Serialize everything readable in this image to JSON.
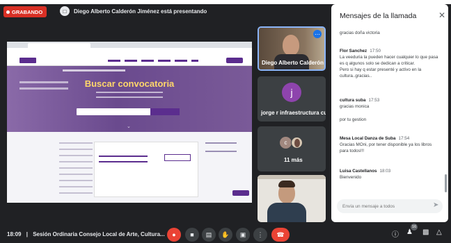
{
  "recording": {
    "label": "GRABANDO"
  },
  "presenter": {
    "text": "Diego Alberto Calderón Jiménez está presentando"
  },
  "shared_screen": {
    "site_title": "Buscar convocatoria"
  },
  "participants": [
    {
      "name": "Diego Alberto Calderón"
    },
    {
      "name": "jorge r infraestructura cul...",
      "initial": "j",
      "avatar_color": "#8e44ad"
    },
    {
      "name": "11 más",
      "initial": "c"
    },
    {
      "name": ""
    }
  ],
  "chat": {
    "title": "Mensajes de la llamada",
    "messages": [
      {
        "sender": "",
        "time": "",
        "lines": [
          "gracias  doña victoria"
        ]
      },
      {
        "sender": "Flor Sanchez",
        "time": "17:50",
        "lines": [
          "La veeduria la pueden hacer cualquier lo que pasa",
          "es q algunos  solo se dedican a criticar.",
          "Pero si hay q estar presenté y activo en la",
          "cultura..gracias.."
        ]
      },
      {
        "sender": "cultura suba",
        "time": "17:53",
        "lines": [
          "gracias monica"
        ]
      },
      {
        "sender": "",
        "time": "",
        "lines": [
          "por  tu  gestion"
        ]
      },
      {
        "sender": "Mesa Local Danza de Suba",
        "time": "17:54",
        "lines": [
          "Gracias MOni, por tener disponible ya los libros",
          "para todos!!!"
        ]
      },
      {
        "sender": "Luisa Castellanos",
        "time": "18:03",
        "lines": [
          "Bienvenido"
        ]
      }
    ],
    "input_placeholder": "Envía un mensaje a todos"
  },
  "footer": {
    "time": "18:09",
    "separator": "|",
    "meeting_title": "Sesión Ordinaria Consejo Local de Arte, Cultura...",
    "people_count": "16"
  },
  "colors": {
    "recording": "#d93025",
    "hangup": "#ea4335",
    "accent": "#8ab4f8",
    "site_purple": "#5b2d8e",
    "site_yellow": "#ffd76a"
  }
}
